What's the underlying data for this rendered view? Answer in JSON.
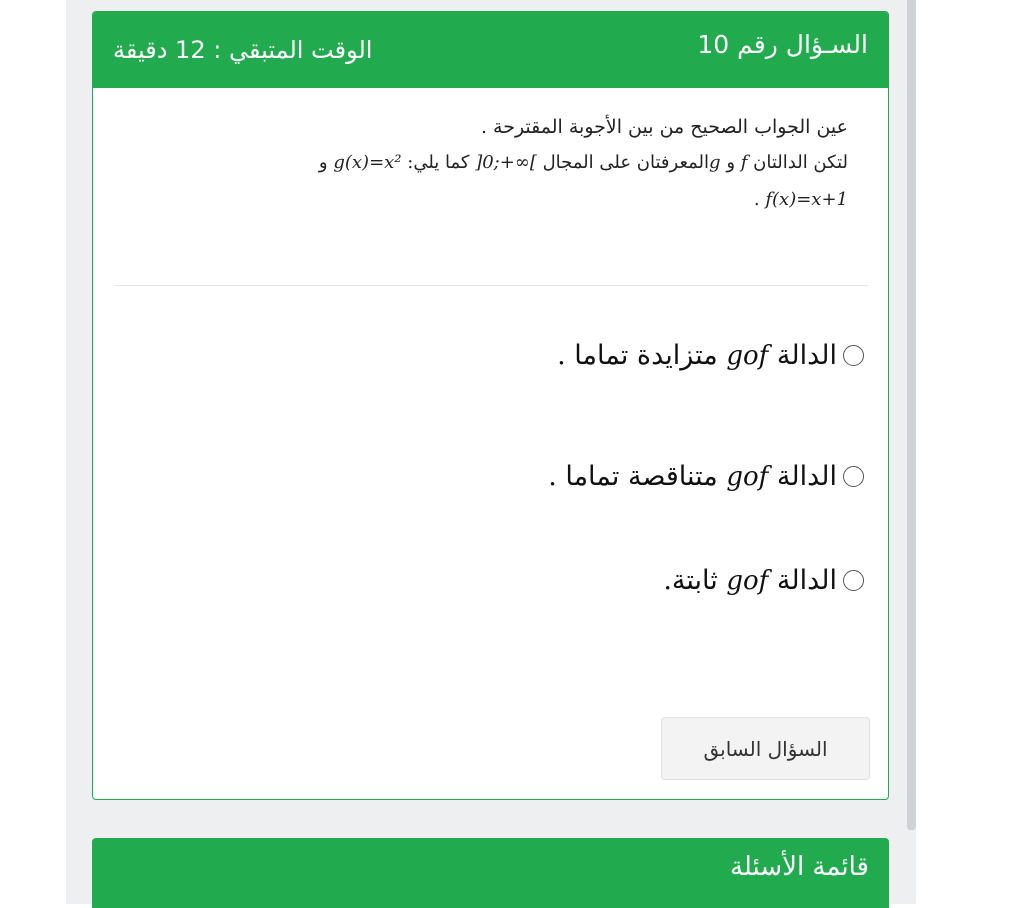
{
  "question": {
    "header_title": "السـؤال رقم 10",
    "time_left": "الوقت المتبقي : 12 دقيقة",
    "instruction": "عين الجواب الصحيح من بين الأجوبة المقترحة .",
    "line2_text_a": "لتكن الدالتان",
    "f": "f",
    "and": "و",
    "g": "g",
    "line2_text_b": "المعرفتان على المجال",
    "interval": "]0;+∞[",
    "line2_text_c": "كما يلي:",
    "g_def": "g(x)=x²",
    "f_def": "f(x)=x+1",
    "period": "."
  },
  "options": [
    {
      "prefix": "الدالة",
      "math": "gof",
      "suffix": "متزايدة تماما ."
    },
    {
      "prefix": "الدالة",
      "math": "gof",
      "suffix": "متناقصة تماما ."
    },
    {
      "prefix": "الدالة",
      "math": "gof",
      "suffix": "ثابتة."
    }
  ],
  "buttons": {
    "previous": "السؤال السابق"
  },
  "questions_list": {
    "title": "قائمة الأسئلة"
  }
}
